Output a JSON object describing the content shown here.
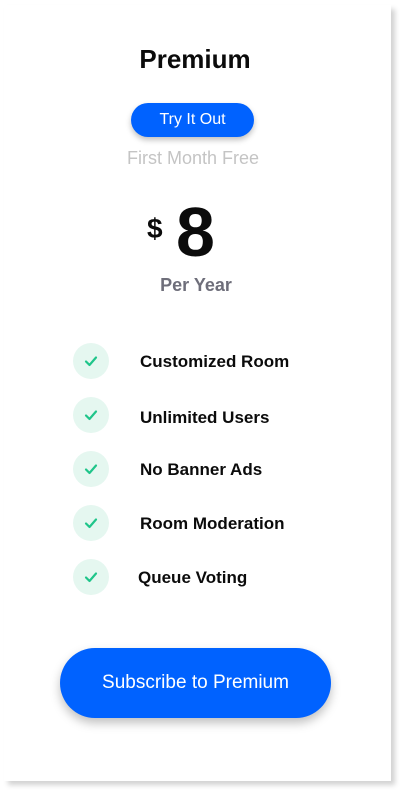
{
  "plan": {
    "title": "Premium",
    "try_label": "Try It Out",
    "trial_note": "First Month Free",
    "currency_symbol": "$",
    "price": "8",
    "period": "Per Year"
  },
  "features": [
    {
      "label": "Customized Room",
      "icon": "check-icon"
    },
    {
      "label": "Unlimited Users",
      "icon": "check-icon"
    },
    {
      "label": "No Banner Ads",
      "icon": "check-icon"
    },
    {
      "label": "Room Moderation",
      "icon": "check-icon"
    },
    {
      "label": "Queue Voting",
      "icon": "check-icon"
    }
  ],
  "cta": {
    "subscribe_label": "Subscribe to Premium"
  },
  "colors": {
    "accent": "#0062ff",
    "check": "#1fc58a",
    "check_bg": "#e5f7f0",
    "muted_text": "#c4c4c4",
    "secondary_text": "#6e6e7a"
  }
}
